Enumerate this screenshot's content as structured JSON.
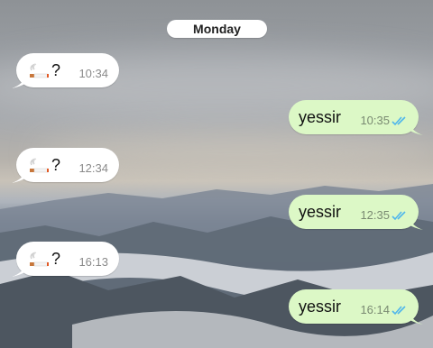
{
  "chat": {
    "date_separator": "Monday",
    "messages": [
      {
        "direction": "in",
        "text": "?",
        "emoji_name": "cigarette-icon",
        "time": "10:34"
      },
      {
        "direction": "out",
        "text": "yessir",
        "time": "10:35",
        "read_receipt": "double-check-read"
      },
      {
        "direction": "in",
        "text": "?",
        "emoji_name": "cigarette-icon",
        "time": "12:34"
      },
      {
        "direction": "out",
        "text": "yessir",
        "time": "12:35",
        "read_receipt": "double-check-read"
      },
      {
        "direction": "in",
        "text": "?",
        "emoji_name": "cigarette-icon",
        "time": "16:13"
      },
      {
        "direction": "out",
        "text": "yessir",
        "time": "16:14",
        "read_receipt": "double-check-read"
      }
    ]
  },
  "colors": {
    "incoming_bubble": "#ffffff",
    "outgoing_bubble": "#dcf8c6",
    "read_tick": "#4fb6ec"
  }
}
